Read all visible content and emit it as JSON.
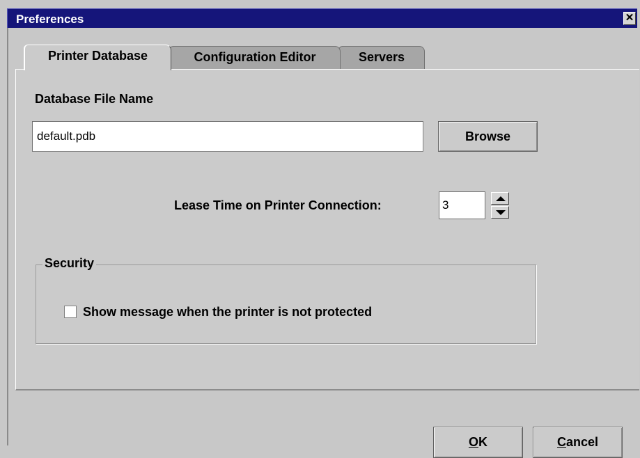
{
  "window": {
    "title": "Preferences",
    "close_icon": "close-icon",
    "close_glyph": "✕"
  },
  "tabs": [
    {
      "label": "Printer Database",
      "selected": true
    },
    {
      "label": "Configuration Editor",
      "selected": false
    },
    {
      "label": "Servers",
      "selected": false
    }
  ],
  "database": {
    "label": "Database File Name",
    "file_name": "default.pdb",
    "browse_label": "Browse"
  },
  "lease": {
    "label": "Lease Time on Printer Connection:",
    "value": "3"
  },
  "security": {
    "group_label": "Security",
    "checkbox_label": "Show message when the printer is not protected",
    "checked": false
  },
  "buttons": {
    "ok_mnemonic": "O",
    "ok_rest": "K",
    "cancel_mnemonic": "C",
    "cancel_rest": "ancel"
  },
  "colors": {
    "title_bar": "#15157a",
    "background": "#cbcbcb",
    "inactive_tab": "#a6a6a6"
  }
}
